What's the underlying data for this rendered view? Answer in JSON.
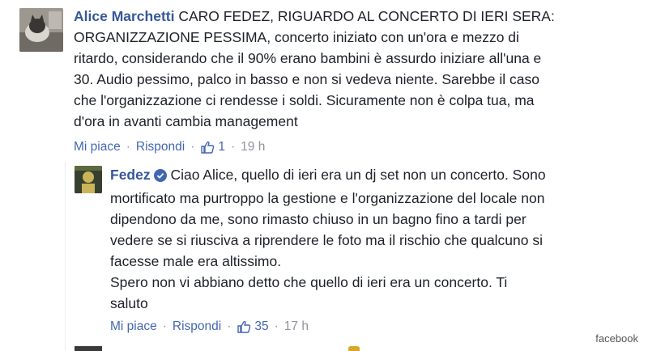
{
  "comment1": {
    "author": "Alice Marchetti",
    "lines": [
      "CARO FEDEZ, RIGUARDO AL CONCERTO DI IERI SERA:",
      "ORGANIZZAZIONE PESSIMA, concerto iniziato con un'ora e mezzo di",
      "ritardo, considerando che il 90% erano bambini è assurdo iniziare all'una e",
      "30. Audio pessimo, palco in basso e non si vedeva niente. Sarebbe il caso",
      "che l'organizzazione ci rendesse i soldi. Sicuramente non è colpa tua, ma",
      "d'ora in avanti cambia management"
    ],
    "like_label": "Mi piace",
    "reply_label": "Rispondi",
    "likes": "1",
    "time": "19 h"
  },
  "reply1": {
    "author": "Fedez",
    "lines": [
      "Ciao Alice, quello di ieri era un dj set non un concerto. Sono",
      "mortificato ma purtroppo la gestione e l'organizzazione del locale non",
      "dipendono da me, sono rimasto chiuso in un bagno fino a tardi per",
      "vedere se si riusciva a riprendere le foto ma il rischio che qualcuno si",
      "facesse male era altissimo.",
      "Spero non vi abbiano detto che quello di ieri era un concerto. Ti",
      "saluto"
    ],
    "like_label": "Mi piace",
    "reply_label": "Rispondi",
    "likes": "35",
    "time": "17 h"
  },
  "watermark": "facebook",
  "colors": {
    "link": "#365899",
    "meta": "#90949c",
    "action": "#4267b2",
    "verified": "#4267b2"
  }
}
